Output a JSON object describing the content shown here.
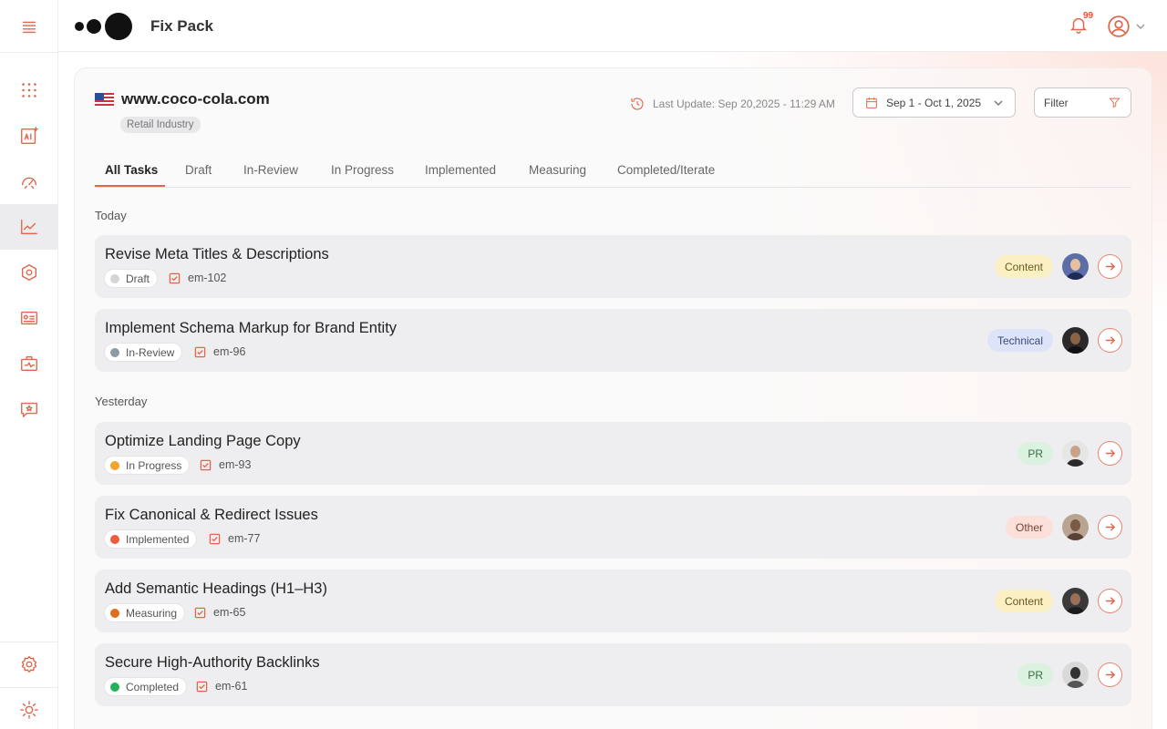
{
  "app": {
    "title": "Fix Pack",
    "notifications_count": "99"
  },
  "sidebar": {
    "items": [
      {
        "icon": "menu-icon"
      },
      {
        "icon": "grid-dots-icon"
      },
      {
        "icon": "ai-icon"
      },
      {
        "icon": "gauge-icon"
      },
      {
        "icon": "trend-chart-icon",
        "active": true
      },
      {
        "icon": "hexagon-settings-icon"
      },
      {
        "icon": "id-card-icon"
      },
      {
        "icon": "briefcase-pulse-icon"
      },
      {
        "icon": "chat-star-icon"
      },
      {
        "icon": "gear-icon"
      },
      {
        "icon": "sun-icon"
      }
    ]
  },
  "site": {
    "name": "www.coco-cola.com",
    "industry": "Retail Industry",
    "flag": "us-flag-icon"
  },
  "toolbar": {
    "last_update": "Last Update: Sep 20,2025 - 11:29 AM",
    "date_range": "Sep 1 - Oct 1, 2025",
    "filter_label": "Filter"
  },
  "tabs": [
    "All Tasks",
    "Draft",
    "In-Review",
    "In Progress",
    "Implemented",
    "Measuring",
    "Completed/Iterate"
  ],
  "groups": {
    "today": "Today",
    "yesterday": "Yesterday"
  },
  "tasks": [
    {
      "title": "Revise Meta Titles & Descriptions",
      "status": "Draft",
      "status_color": "#d4d4d4",
      "id": "em-102",
      "tag": "Content",
      "tag_bg": "#fbefc4",
      "tag_color": "#6b5a1e"
    },
    {
      "title": "Implement Schema Markup for Brand Entity",
      "status": "In-Review",
      "status_color": "#8c9aa5",
      "id": "em-96",
      "tag": "Technical",
      "tag_bg": "#dde3f8",
      "tag_color": "#3b4a7a"
    },
    {
      "title": "Optimize Landing Page Copy",
      "status": "In Progress",
      "status_color": "#f5a32a",
      "id": "em-93",
      "tag": "PR",
      "tag_bg": "#daf2df",
      "tag_color": "#3d6b47"
    },
    {
      "title": "Fix Canonical & Redirect Issues",
      "status": "Implemented",
      "status_color": "#ef5b3f",
      "id": "em-77",
      "tag": "Other",
      "tag_bg": "#fbe0da",
      "tag_color": "#7a4236"
    },
    {
      "title": "Add Semantic Headings (H1–H3)",
      "status": "Measuring",
      "status_color": "#df6d1c",
      "id": "em-65",
      "tag": "Content",
      "tag_bg": "#fbefc4",
      "tag_color": "#6b5a1e"
    },
    {
      "title": "Secure High-Authority Backlinks",
      "status": "Completed",
      "status_color": "#23b25a",
      "id": "em-61",
      "tag": "PR",
      "tag_bg": "#daf2df",
      "tag_color": "#3d6b47"
    }
  ],
  "colors": {
    "accent": "#e2674a"
  }
}
